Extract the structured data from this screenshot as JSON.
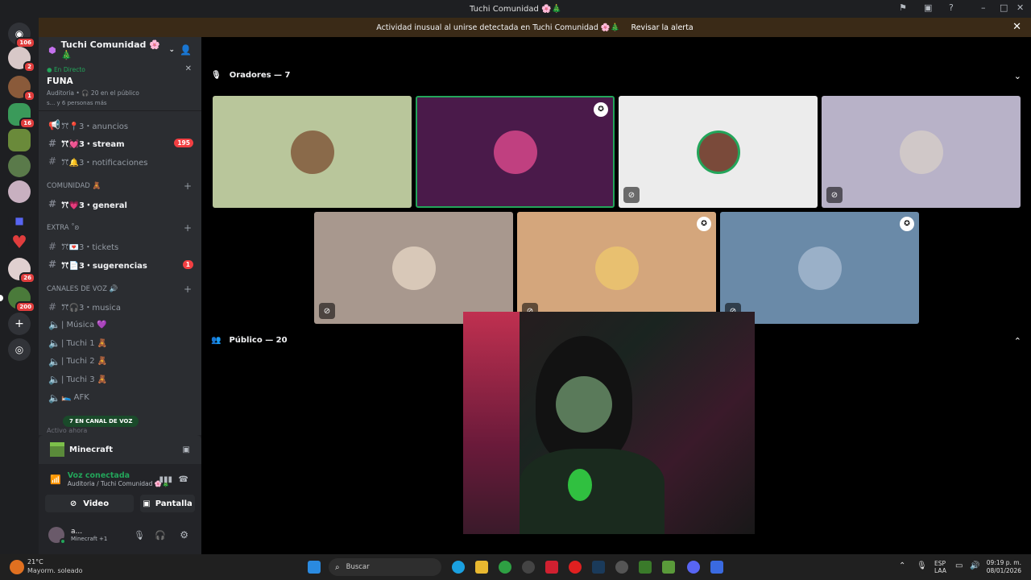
{
  "window": {
    "title": "Tuchi Comunidad 🌸🎄"
  },
  "alert": {
    "text": "Actividad inusual al unirse detectada en Tuchi Comunidad 🌸🎄",
    "action_label": "Revisar la alerta"
  },
  "guilds": {
    "home_badge": "106",
    "badges": [
      "2",
      "1",
      "16",
      "26",
      "200"
    ]
  },
  "server": {
    "name": "Tuchi Comunidad 🌸🎄",
    "live_label": "En Directo",
    "stage_title": "FUNA",
    "stage_meta": "Auditoria • 🎧 20 en el público",
    "stage_people": "s... y 6 personas más"
  },
  "channels": [
    {
      "icon": "📢",
      "label": "ꔫ📍3・anuncios",
      "unread": false,
      "badge": ""
    },
    {
      "icon": "#",
      "label": "ꔫ💓3・stream",
      "unread": true,
      "badge": "195"
    },
    {
      "icon": "#",
      "label": "ꔫ🔔3・notificaciones",
      "unread": false,
      "badge": ""
    }
  ],
  "categories": {
    "comunidad": "COMUNIDAD 🧸",
    "extra": "EXTRA ˚ʚ",
    "voice": "CANALES DE VOZ 🔊"
  },
  "comunidad_channels": [
    {
      "label": "ꔫ💗3・general",
      "unread": true
    }
  ],
  "extra_channels": [
    {
      "label": "ꔫ💌3・tickets",
      "unread": false,
      "badge": ""
    },
    {
      "label": "ꔫ📄3・sugerencias",
      "unread": true,
      "badge": "1"
    }
  ],
  "voice_channels": [
    {
      "label": "ꔫ🎧3・musica"
    },
    {
      "label": "| Música 💜"
    },
    {
      "label": "| Tuchi 1 🧸"
    },
    {
      "label": "| Tuchi 2 🧸"
    },
    {
      "label": "| Tuchi 3 🧸"
    },
    {
      "label": "🛌 AFK"
    }
  ],
  "voice_pill": "7 EN CANAL DE VOZ",
  "activity_label": "Activo ahora",
  "game": {
    "name": "Minecraft"
  },
  "voice_status": {
    "title": "Voz conectada",
    "subtitle": "Auditoria / Tuchi Comunidad 🌸🎄"
  },
  "buttons": {
    "video": "Video",
    "screen": "Pantalla"
  },
  "user": {
    "name": "a...",
    "status": "Minecraft +1"
  },
  "stage": {
    "speakers_label": "Oradores — 7",
    "audience_label": "Público — 20"
  },
  "taskbar": {
    "weather_temp": "21°C",
    "weather_desc": "Mayorm. soleado",
    "search_placeholder": "Buscar",
    "lang_line1": "ESP",
    "lang_line2": "LAA",
    "time": "09:19 p. m.",
    "date": "08/01/2026"
  },
  "colors": {
    "accent": "#5865f2",
    "online": "#23a55a",
    "alert_bg": "#3a2a17",
    "badge": "#f23f42"
  }
}
